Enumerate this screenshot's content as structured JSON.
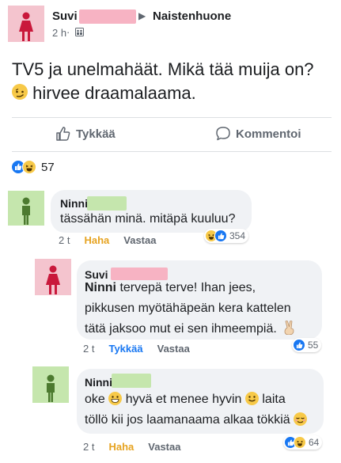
{
  "post": {
    "author": "Suvi",
    "arrow": "▶",
    "group": "Naistenhuone",
    "time": "2 h",
    "dot": "·",
    "body_line1": "TV5 ja unelmahäät. Mikä tää muija on?",
    "body_line2": "hirvee draamalaama.",
    "like_label": "Tykkää",
    "comment_label": "Kommentoi",
    "reaction_count": "57"
  },
  "comments": [
    {
      "author": "Ninni",
      "text": "tässähän minä. mitäpä kuuluu?",
      "time": "2 t",
      "action1": "Haha",
      "action2": "Vastaa",
      "reaction_count": "354"
    },
    {
      "author": "Suvi",
      "mention": "Ninni",
      "line1": "tervepä terve! Ihan jees,",
      "line2": "pikkusen myötähäpeän kera kattelen",
      "line3": "tätä jaksoo mut ei sen ihmeempiä.",
      "time": "2 t",
      "action1": "Tykkää",
      "action2": "Vastaa",
      "reaction_count": "55"
    },
    {
      "author": "Ninni",
      "l1a": "oke",
      "l1b": "hyvä et menee hyvin",
      "l1c": "laita",
      "line2": "töllö kii jos laamanaama alkaa tökkiä",
      "time": "2 t",
      "action1": "Haha",
      "action2": "Vastaa",
      "reaction_count": "64"
    }
  ],
  "colors": {
    "like_blue": "#1877f2",
    "haha_yellow": "#f7c948",
    "haha_label": "#e6a321",
    "avatar_pink": "#f4c4ce",
    "avatar_green": "#c5e6ad",
    "bubble_bg": "#f0f2f5"
  },
  "icons": [
    "person-silhouette-icon",
    "group-audience-icon",
    "thumbs-up-icon",
    "comment-bubble-icon",
    "like-reaction-icon",
    "haha-reaction-icon",
    "smirk-emoji-icon",
    "grin-emoji-icon",
    "smile-emoji-icon",
    "victory-hand-icon"
  ]
}
